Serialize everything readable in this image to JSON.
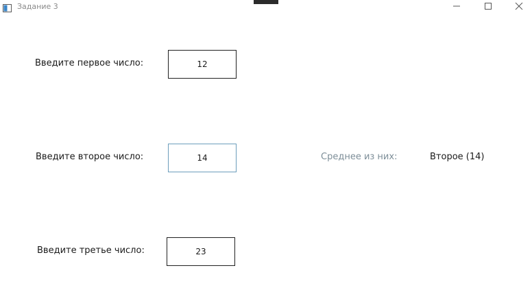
{
  "window": {
    "title": "Задание 3"
  },
  "form": {
    "first_label": "Введите первое число:",
    "first_value": "12",
    "second_label": "Введите второе число:",
    "second_value": "14",
    "third_label": "Введите третье число:",
    "third_value": "23",
    "result_label": "Среднее из них:",
    "result_value": "Второе (14)"
  },
  "colors": {
    "muted_label": "#7d8e98",
    "focused_border": "#6b9dbb",
    "box_border": "#1f1f1f"
  },
  "icons": {
    "app": "app-window-icon",
    "minimize": "minimize-icon",
    "maximize": "maximize-icon",
    "close": "close-icon"
  }
}
